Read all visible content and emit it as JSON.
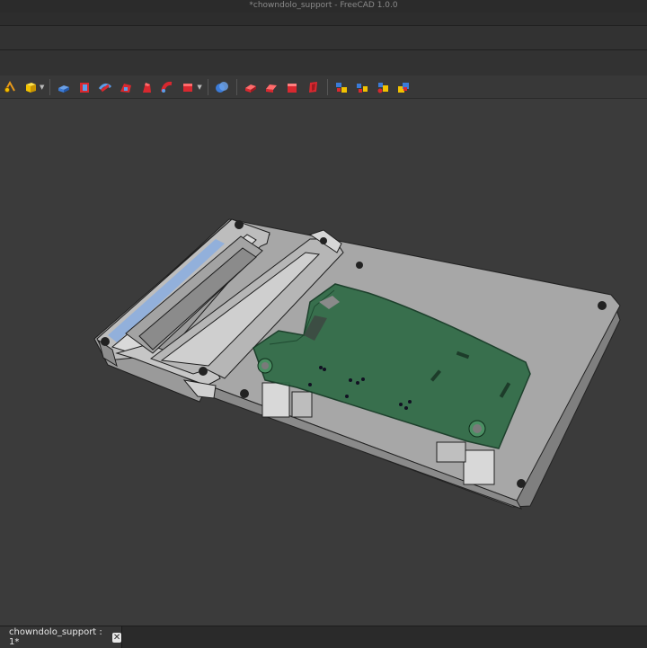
{
  "window": {
    "title": "*chowndolo_support - FreeCAD 1.0.0"
  },
  "toolbar": {
    "icons": [
      "sketch-attach-icon",
      "part-box-icon",
      "pad-icon",
      "pocket-icon",
      "revolve-icon",
      "groove-icon",
      "loft-icon",
      "sweep-icon",
      "boolean-icon",
      "fillet-icon",
      "chamfer-icon",
      "draft-icon",
      "thickness-icon",
      "mirror-icon",
      "linear-pattern-icon",
      "polar-pattern-icon",
      "multi-transform-icon"
    ]
  },
  "document_tab": {
    "label": "chowndolo_support : 1*",
    "close": "✕"
  },
  "colors": {
    "background": "#3b3b3b",
    "part_gray": "#a9a9a9",
    "pcb_green": "#2f6b46",
    "accent_red": "#d8282f",
    "accent_yellow": "#f2c200",
    "accent_blue": "#3b7bd8"
  }
}
